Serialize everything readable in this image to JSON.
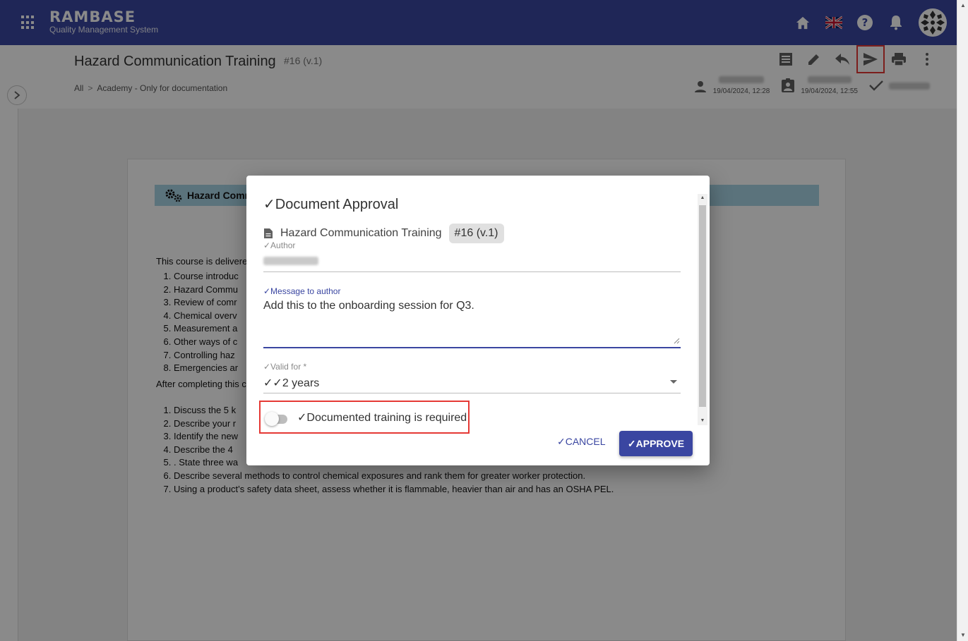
{
  "app": {
    "brand_name": "RAMBASE",
    "brand_sub": "Quality Management System",
    "icons": [
      "apps-grid-icon",
      "home-icon",
      "uk-flag-icon",
      "help-icon",
      "notifications-icon",
      "avatar"
    ]
  },
  "document": {
    "title": "Hazard Communication Training",
    "version": "#16 (v.1)",
    "breadcrumb": [
      "All",
      "Academy - Only for documentation"
    ],
    "toolbar_icons": [
      "document-list-icon",
      "edit-icon",
      "reply-icon",
      "send-icon",
      "print-icon",
      "more-vert-icon"
    ],
    "meta": {
      "author_date": "19/04/2024, 12:28",
      "approver_date": "19/04/2024, 12:55"
    }
  },
  "page_content": {
    "banner": "Hazard Comm",
    "intro": "This course is delivere",
    "list1": [
      "Course introduc",
      "Hazard Commu",
      "Review of comr",
      "Chemical overv",
      "Measurement a",
      "Other ways of c",
      "Controlling haz",
      "Emergencies ar"
    ],
    "after": "After completing this c",
    "list2": [
      "Discuss the 5 k",
      "Describe your r",
      "Identify the new",
      "Describe the 4",
      ". State three wa",
      "Describe several methods to control chemical exposures and rank them for greater worker protection.",
      "Using a product’s safety data sheet, assess whether it is flammable, heavier than air and has an OSHA PEL."
    ]
  },
  "modal": {
    "title": "✓Document Approval",
    "doc_name": "Hazard Communication Training",
    "doc_version": "#16 (v.1)",
    "author_label": "✓Author",
    "message_label": "✓Message to author",
    "message_value": "Add this to the onboarding session for Q3.",
    "valid_label": "✓Valid for *",
    "valid_value": "✓✓2 years",
    "toggle_label": "✓Documented training is required",
    "toggle_on": false,
    "cancel_label": "✓CANCEL",
    "approve_label": "✓APPROVE",
    "accent_color": "#3a46a1",
    "highlight_color": "#e53935"
  }
}
